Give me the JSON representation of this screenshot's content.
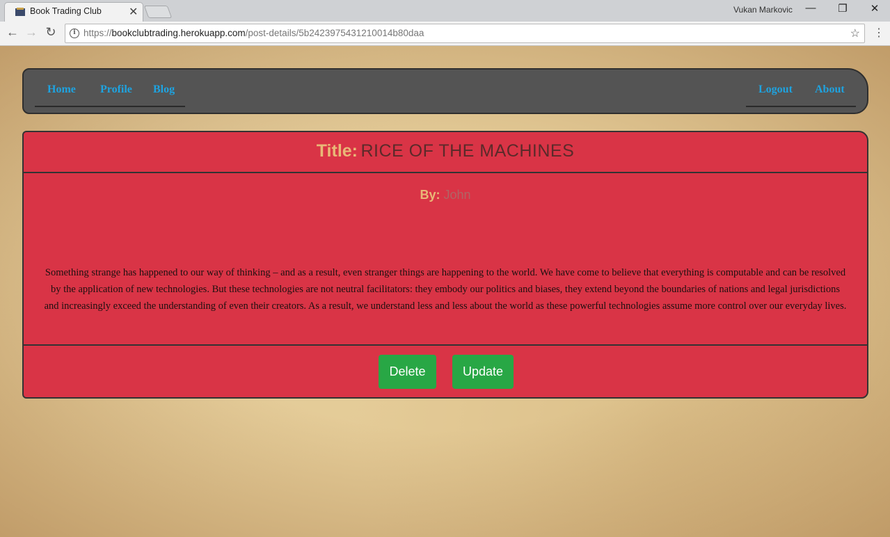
{
  "browser": {
    "tab_title": "Book Trading Club",
    "profile_name": "Vukan Markovic",
    "url_scheme": "https://",
    "url_host": "bookclubtrading.herokuapp.com",
    "url_path": "/post-details/5b2423975431210014b80daa"
  },
  "nav": {
    "left": [
      "Home",
      "Profile",
      "Blog"
    ],
    "right": [
      "Logout",
      "About"
    ]
  },
  "post": {
    "title_label": "Title:",
    "title": "RICE OF THE MACHINES",
    "author_label": "By:",
    "author": "John",
    "body": "Something strange has happened to our way of thinking – and as a result, even stranger things are happening to the world. We have come to believe that everything is computable and can be resolved by the application of new technologies. But these technologies are not neutral facilitators: they embody our politics and biases, they extend beyond the boundaries of nations and legal jurisdictions and increasingly exceed the understanding of even their creators. As a result, we understand less and less about the world as these powerful technologies assume more control over our everyday lives."
  },
  "actions": {
    "delete_label": "Delete",
    "update_label": "Update"
  },
  "colors": {
    "card": "#d93446",
    "navbar": "#545454",
    "nav_link": "#1ea3e0",
    "button": "#28a745",
    "label": "#e9b877"
  }
}
